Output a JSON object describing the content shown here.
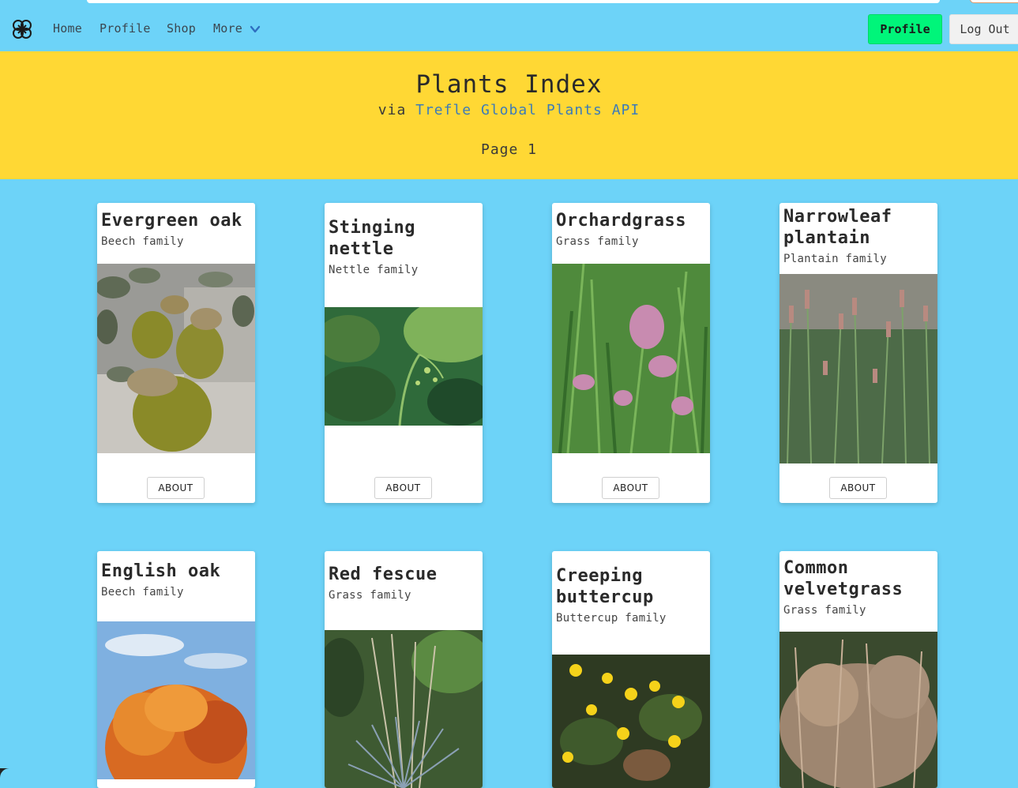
{
  "nav": {
    "home": "Home",
    "profile": "Profile",
    "shop": "Shop",
    "more": "More",
    "profile_button": "Profile",
    "logout_button": "Log Out"
  },
  "hero": {
    "title": "Plants Index",
    "via": "via",
    "api_link": "Trefle Global Plants API",
    "page": "Page 1"
  },
  "cards": [
    {
      "name": "Evergreen oak",
      "family": "Beech family",
      "about": "ABOUT"
    },
    {
      "name": "Stinging nettle",
      "family": "Nettle family",
      "about": "ABOUT"
    },
    {
      "name": "Orchardgrass",
      "family": "Grass family",
      "about": "ABOUT"
    },
    {
      "name": "Narrowleaf plantain",
      "family": "Plantain family",
      "about": "ABOUT"
    },
    {
      "name": "English oak",
      "family": "Beech family"
    },
    {
      "name": "Red fescue",
      "family": "Grass family"
    },
    {
      "name": "Creeping buttercup",
      "family": "Buttercup family"
    },
    {
      "name": "Common velvetgrass",
      "family": "Grass family"
    }
  ],
  "colors": {
    "background": "#6dd3f8",
    "hero": "#ffd834",
    "profile_button": "#00f57a",
    "link": "#3d7bb8"
  }
}
